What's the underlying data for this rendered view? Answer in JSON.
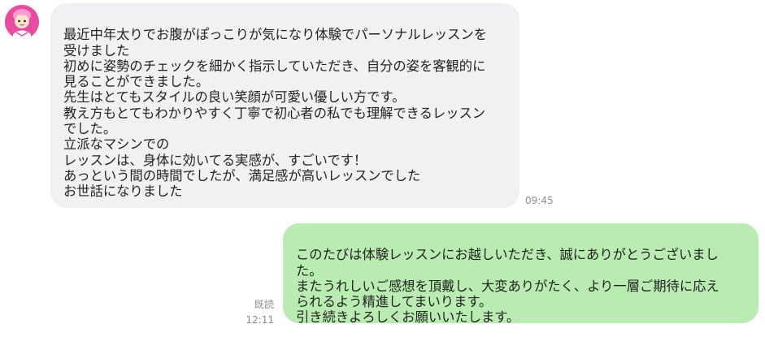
{
  "incoming": {
    "text": "最近中年太りでお腹がぽっこりが気になり体験でパーソナルレッスンを\n受けました\n初めに姿勢のチェックを細かく指示していただき、自分の姿を客観的に\n見ることができました。\n先生はとてもスタイルの良い笑顔が可愛い優しい方です。\n教え方もとてもわかりやすく丁寧で初心者の私でも理解できるレッスン\nでした。\n立派なマシンでの\nレッスンは、身体に効いてる実感が、すごいです！\nあっという間の時間でしたが、満足感が高いレッスンでした\nお世話になりました",
    "time": "09:45"
  },
  "outgoing": {
    "text": "このたびは体験レッスンにお越しいただき、誠にありがとうございまし\nた。\nまたうれしいご感想を頂戴し、大変ありがたく、より一層ご期待に応え\nられるよう精進してまいります。\n引き続きよろしくお願いいたします。",
    "read_label": "既読",
    "time": "12:11"
  },
  "colors": {
    "incoming_bubble": "#f0f1f3",
    "outgoing_bubble": "#b9ecb1",
    "avatar_accent": "#e8469a",
    "timestamp": "#8c8c8c"
  }
}
